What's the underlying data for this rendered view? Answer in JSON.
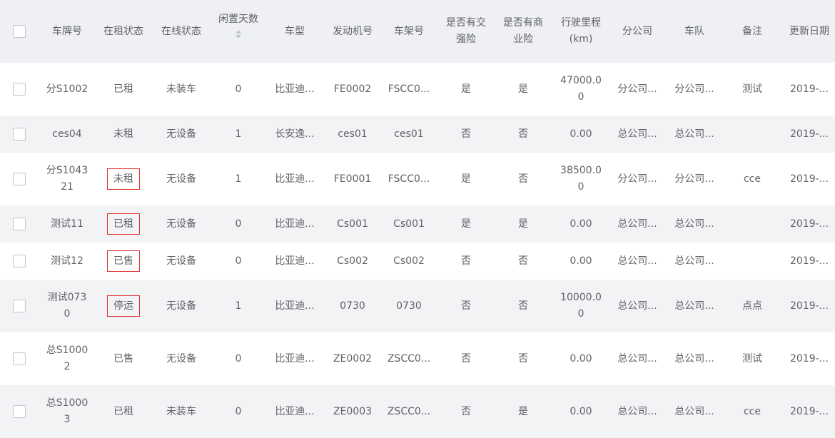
{
  "columns": [
    {
      "key": "check",
      "label": ""
    },
    {
      "key": "plate",
      "label": "车牌号"
    },
    {
      "key": "rent",
      "label": "在租状态"
    },
    {
      "key": "online",
      "label": "在线状态"
    },
    {
      "key": "idle",
      "label": "闲置天数",
      "sortable": true
    },
    {
      "key": "model",
      "label": "车型"
    },
    {
      "key": "engine",
      "label": "发动机号"
    },
    {
      "key": "frame",
      "label": "车架号"
    },
    {
      "key": "jqx",
      "label": "是否有交\n强险"
    },
    {
      "key": "syx",
      "label": "是否有商\n业险"
    },
    {
      "key": "mileage",
      "label": "行驶里程\n(km)"
    },
    {
      "key": "branch",
      "label": "分公司"
    },
    {
      "key": "team",
      "label": "车队"
    },
    {
      "key": "remark",
      "label": "备注"
    },
    {
      "key": "date",
      "label": "更新日期"
    }
  ],
  "rows": [
    {
      "plate": "分S1002",
      "rent": "已租",
      "rent_boxed": false,
      "online": "未装车",
      "idle": "0",
      "model": "比亚迪...",
      "engine": "FE0002",
      "frame": "FSCC0...",
      "jqx": "是",
      "syx": "是",
      "mileage": "47000.0\n0",
      "branch": "分公司...",
      "team": "分公司...",
      "remark": "测试",
      "date": "2019-..."
    },
    {
      "plate": "ces04",
      "rent": "未租",
      "rent_boxed": false,
      "online": "无设备",
      "idle": "1",
      "model": "长安逸...",
      "engine": "ces01",
      "frame": "ces01",
      "jqx": "否",
      "syx": "否",
      "mileage": "0.00",
      "branch": "总公司...",
      "team": "总公司...",
      "remark": "",
      "date": "2019-..."
    },
    {
      "plate": "分S1043\n21",
      "rent": "未租",
      "rent_boxed": true,
      "online": "无设备",
      "idle": "1",
      "model": "比亚迪...",
      "engine": "FE0001",
      "frame": "FSCC0...",
      "jqx": "是",
      "syx": "否",
      "mileage": "38500.0\n0",
      "branch": "分公司...",
      "team": "分公司...",
      "remark": "cce",
      "date": "2019-..."
    },
    {
      "plate": "测试11",
      "rent": "已租",
      "rent_boxed": true,
      "online": "无设备",
      "idle": "0",
      "model": "比亚迪...",
      "engine": "Cs001",
      "frame": "Cs001",
      "jqx": "是",
      "syx": "是",
      "mileage": "0.00",
      "branch": "总公司...",
      "team": "总公司...",
      "remark": "",
      "date": "2019-..."
    },
    {
      "plate": "测试12",
      "rent": "已售",
      "rent_boxed": true,
      "online": "无设备",
      "idle": "0",
      "model": "比亚迪...",
      "engine": "Cs002",
      "frame": "Cs002",
      "jqx": "否",
      "syx": "否",
      "mileage": "0.00",
      "branch": "总公司...",
      "team": "总公司...",
      "remark": "",
      "date": "2019-..."
    },
    {
      "plate": "测试073\n0",
      "rent": "停运",
      "rent_boxed": true,
      "online": "无设备",
      "idle": "1",
      "model": "比亚迪...",
      "engine": "0730",
      "frame": "0730",
      "jqx": "否",
      "syx": "否",
      "mileage": "10000.0\n0",
      "branch": "总公司...",
      "team": "总公司...",
      "remark": "点点",
      "date": "2019-..."
    },
    {
      "plate": "总S1000\n2",
      "rent": "已售",
      "rent_boxed": false,
      "online": "无设备",
      "idle": "0",
      "model": "比亚迪...",
      "engine": "ZE0002",
      "frame": "ZSCC0...",
      "jqx": "否",
      "syx": "否",
      "mileage": "0.00",
      "branch": "总公司...",
      "team": "总公司...",
      "remark": "测试",
      "date": "2019-..."
    },
    {
      "plate": "总S1000\n3",
      "rent": "已租",
      "rent_boxed": false,
      "online": "未装车",
      "idle": "0",
      "model": "比亚迪...",
      "engine": "ZE0003",
      "frame": "ZSCC0...",
      "jqx": "否",
      "syx": "是",
      "mileage": "0.00",
      "branch": "总公司...",
      "team": "总公司...",
      "remark": "cce",
      "date": "2019-..."
    }
  ],
  "icons": {
    "sort": "sort-caret-icon",
    "checkbox": "checkbox-icon"
  },
  "colors": {
    "header_bg": "#eef0f3",
    "stripe_bg": "#f2f3f5",
    "highlight_border": "#e0312f",
    "text": "#606266"
  }
}
